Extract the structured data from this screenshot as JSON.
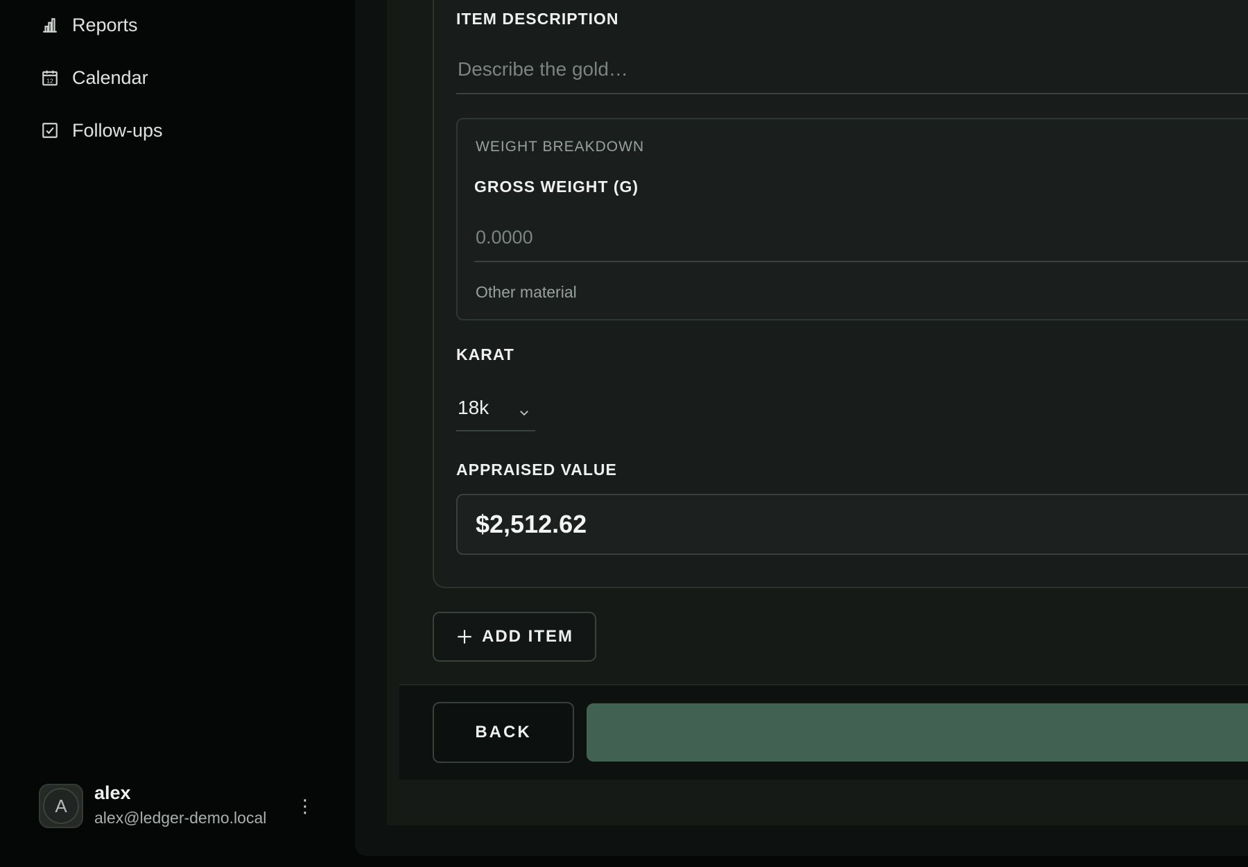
{
  "sidebar": {
    "items": [
      {
        "label": "Reports",
        "icon": "bar-chart-icon"
      },
      {
        "label": "Calendar",
        "icon": "calendar-icon"
      },
      {
        "label": "Follow-ups",
        "icon": "checkbox-icon"
      }
    ],
    "calendar_icon_day": "12",
    "user": {
      "initial": "A",
      "name": "alex",
      "email": "alex@ledger-demo.local",
      "menu_icon": "⋮"
    }
  },
  "form": {
    "item_description": {
      "label": "ITEM DESCRIPTION",
      "placeholder": "Describe the gold…",
      "value": ""
    },
    "weight_breakdown": {
      "title": "WEIGHT BREAKDOWN",
      "gross_weight_label": "GROSS WEIGHT (G)",
      "gross_weight_placeholder": "0.0000",
      "other_material_label": "Other material"
    },
    "karat": {
      "label": "KARAT",
      "selected": "18k"
    },
    "appraised_value": {
      "label": "APPRAISED VALUE",
      "value": "$2,512.62"
    },
    "add_item_label": "ADD ITEM"
  },
  "footer": {
    "back_label": "BACK",
    "primary_label": ""
  },
  "colors": {
    "sidebar_bg": "#050706",
    "panel_bg": "#151a17",
    "primary_button": "#416152",
    "text": "#eef1ef"
  }
}
